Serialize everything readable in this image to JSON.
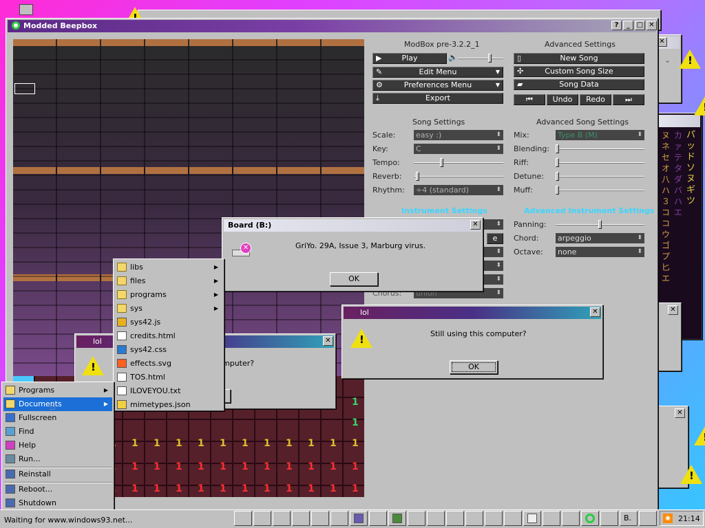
{
  "beepbox": {
    "title": "Modded Beepbox",
    "version": "ModBox pre-3.2.2_1",
    "play": "Play",
    "edit_menu": "Edit Menu",
    "preferences_menu": "Preferences Menu",
    "export": "Export",
    "advanced_settings": "Advanced Settings",
    "new_song": "New Song",
    "custom_song_size": "Custom Song Size",
    "song_data": "Song Data",
    "undo": "Undo",
    "redo": "Redo",
    "song_settings": "Song Settings",
    "advanced_song_settings": "Advanced Song Settings",
    "scale_label": "Scale:",
    "scale_value": "easy :)",
    "key_label": "Key:",
    "key_value": "C",
    "tempo_label": "Tempo:",
    "reverb_label": "Reverb:",
    "rhythm_label": "Rhythm:",
    "rhythm_value": "÷4 (standard)",
    "mix_label": "Mix:",
    "mix_value": "Type B (M)",
    "blending_label": "Blending:",
    "riff_label": "Riff:",
    "detune_label": "Detune:",
    "muff_label": "Muff:",
    "instrument_settings": "Instrument Settings",
    "advanced_instrument_settings": "Advanced Instrument Settings",
    "panning_label": "Panning:",
    "chord_label": "Chord:",
    "chord_value": "arpeggio",
    "octave_label": "Octave:",
    "octave_value": "none",
    "chorus_label": "Chorus:",
    "chorus_value": "union",
    "grid_digits": [
      "1",
      "1",
      "1",
      "1",
      "1",
      "1",
      "1",
      "1",
      "1",
      "1",
      "1",
      "1",
      "1",
      "1",
      "1",
      "1"
    ],
    "sliders": {
      "tempo": 0.3,
      "reverb": 0.02,
      "panning": 0.5,
      "volume": 0.72
    }
  },
  "board_dialog": {
    "title": "Board (B:)",
    "message": "GriYo. 29A, Issue 3, Marburg virus.",
    "ok": "OK"
  },
  "lol_dialog": {
    "title": "lol",
    "message": "Still using this computer?",
    "ok": "OK"
  },
  "lol_dialog_back": {
    "title": "lol",
    "partial": "mputer?"
  },
  "start_menu": {
    "items": [
      {
        "label": "Programs",
        "arrow": true
      },
      {
        "label": "Documents",
        "arrow": true
      },
      {
        "label": "Fullscreen"
      },
      {
        "label": "Find"
      },
      {
        "label": "Help"
      },
      {
        "label": "Run..."
      },
      {
        "label": "Reinstall"
      },
      {
        "label": "Reboot..."
      },
      {
        "label": "Shutdown"
      }
    ]
  },
  "documents_menu": {
    "items": [
      {
        "label": "libs",
        "type": "folder",
        "arrow": true
      },
      {
        "label": "files",
        "type": "folder",
        "arrow": true
      },
      {
        "label": "programs",
        "type": "folder",
        "arrow": true
      },
      {
        "label": "sys",
        "type": "folder",
        "arrow": true
      },
      {
        "label": "sys42.js",
        "type": "js"
      },
      {
        "label": "credits.html",
        "type": "html"
      },
      {
        "label": "sys42.css",
        "type": "css"
      },
      {
        "label": "effects.svg",
        "type": "svg"
      },
      {
        "label": "TOS.html",
        "type": "html"
      },
      {
        "label": "ILOVEYOU.txt",
        "type": "txt"
      },
      {
        "label": "mimetypes.json",
        "type": "json"
      }
    ]
  },
  "katakana": {
    "col1": "パッドソヌギツ",
    "col2": "カァテタダバハエ",
    "col3": "ヌネセオ八ハ３ココウゴプ匕エ"
  },
  "taskbar": {
    "status": "Waiting for www.windows93.net...",
    "clock": "21:14",
    "b_label": "B."
  },
  "colors": {
    "accent": "#5b2a86",
    "beepbox_bg": "#1e1e1e",
    "section_heading": "#3ad6ff",
    "warning": "#f0e010"
  }
}
